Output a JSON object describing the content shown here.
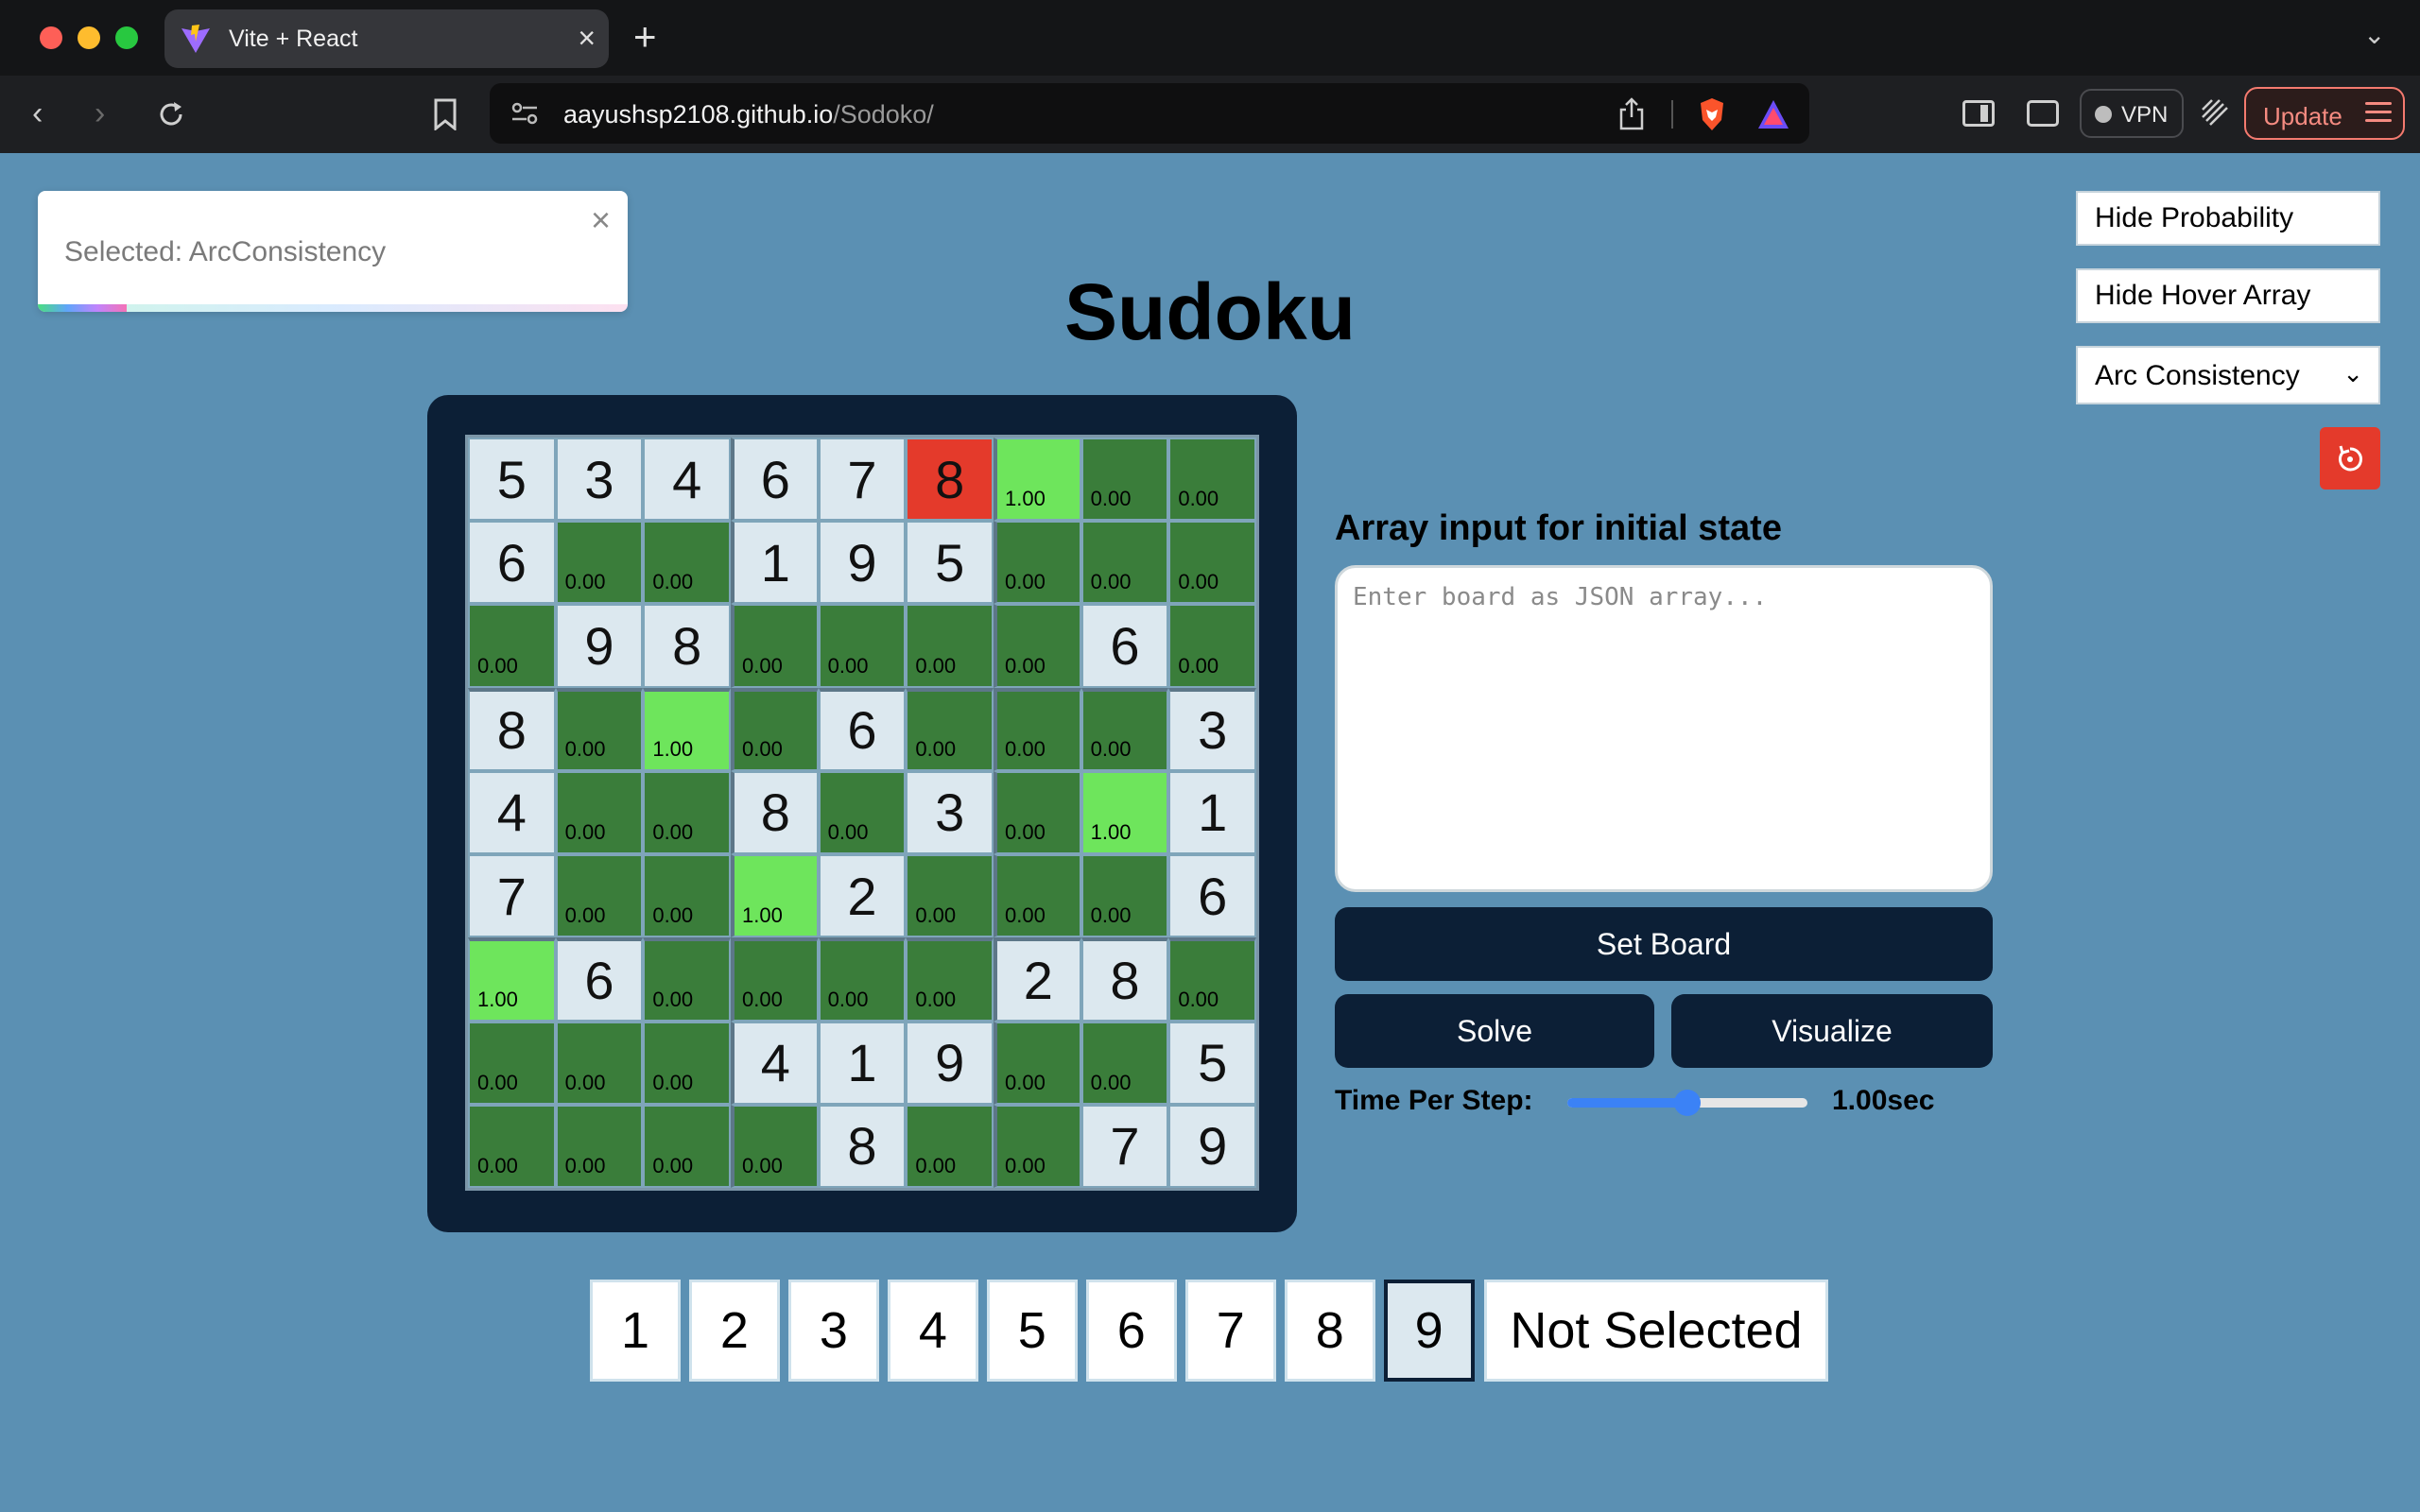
{
  "browser": {
    "tab_title": "Vite + React",
    "tab_close": "×",
    "new_tab": "+",
    "url_host": "aayushsp2108.github.io",
    "url_path": "/Sodoko/",
    "vpn_label": "VPN",
    "update_label": "Update"
  },
  "toast": {
    "message": "Selected: ArcConsistency",
    "close": "×",
    "progress_fraction": 0.15
  },
  "page": {
    "title": "Sudoku",
    "array_label": "Array input for initial state",
    "input_placeholder": "Enter board as JSON array...",
    "input_value": "",
    "set_board_label": "Set Board",
    "solve_label": "Solve",
    "visualize_label": "Visualize",
    "time_label": "Time Per Step:",
    "time_value": "1.00sec",
    "time_slider_fraction": 0.5
  },
  "controls": {
    "hide_probability": "Hide Probability",
    "hide_hover_array": "Hide Hover Array",
    "algorithm_selected": "Arc Consistency",
    "reset_icon": "reset-icon"
  },
  "board": [
    [
      {
        "v": "5",
        "s": "given"
      },
      {
        "v": "3",
        "s": "given"
      },
      {
        "v": "4",
        "s": "given"
      },
      {
        "v": "6",
        "s": "given"
      },
      {
        "v": "7",
        "s": "given"
      },
      {
        "v": "8",
        "s": "conflict"
      },
      {
        "p": "1.00",
        "s": "bright"
      },
      {
        "p": "0.00",
        "s": "empty"
      },
      {
        "p": "0.00",
        "s": "empty"
      }
    ],
    [
      {
        "v": "6",
        "s": "given"
      },
      {
        "p": "0.00",
        "s": "empty"
      },
      {
        "p": "0.00",
        "s": "empty"
      },
      {
        "v": "1",
        "s": "given"
      },
      {
        "v": "9",
        "s": "given"
      },
      {
        "v": "5",
        "s": "given"
      },
      {
        "p": "0.00",
        "s": "empty"
      },
      {
        "p": "0.00",
        "s": "empty"
      },
      {
        "p": "0.00",
        "s": "empty"
      }
    ],
    [
      {
        "p": "0.00",
        "s": "empty"
      },
      {
        "v": "9",
        "s": "given"
      },
      {
        "v": "8",
        "s": "given"
      },
      {
        "p": "0.00",
        "s": "empty"
      },
      {
        "p": "0.00",
        "s": "empty"
      },
      {
        "p": "0.00",
        "s": "empty"
      },
      {
        "p": "0.00",
        "s": "empty"
      },
      {
        "v": "6",
        "s": "given"
      },
      {
        "p": "0.00",
        "s": "empty"
      }
    ],
    [
      {
        "v": "8",
        "s": "given"
      },
      {
        "p": "0.00",
        "s": "empty"
      },
      {
        "p": "1.00",
        "s": "bright"
      },
      {
        "p": "0.00",
        "s": "empty"
      },
      {
        "v": "6",
        "s": "given"
      },
      {
        "p": "0.00",
        "s": "empty"
      },
      {
        "p": "0.00",
        "s": "empty"
      },
      {
        "p": "0.00",
        "s": "empty"
      },
      {
        "v": "3",
        "s": "given"
      }
    ],
    [
      {
        "v": "4",
        "s": "given"
      },
      {
        "p": "0.00",
        "s": "empty"
      },
      {
        "p": "0.00",
        "s": "empty"
      },
      {
        "v": "8",
        "s": "given"
      },
      {
        "p": "0.00",
        "s": "empty"
      },
      {
        "v": "3",
        "s": "given"
      },
      {
        "p": "0.00",
        "s": "empty"
      },
      {
        "p": "1.00",
        "s": "bright"
      },
      {
        "v": "1",
        "s": "given"
      }
    ],
    [
      {
        "v": "7",
        "s": "given"
      },
      {
        "p": "0.00",
        "s": "empty"
      },
      {
        "p": "0.00",
        "s": "empty"
      },
      {
        "p": "1.00",
        "s": "bright"
      },
      {
        "v": "2",
        "s": "given"
      },
      {
        "p": "0.00",
        "s": "empty"
      },
      {
        "p": "0.00",
        "s": "empty"
      },
      {
        "p": "0.00",
        "s": "empty"
      },
      {
        "v": "6",
        "s": "given"
      }
    ],
    [
      {
        "p": "1.00",
        "s": "bright"
      },
      {
        "v": "6",
        "s": "given"
      },
      {
        "p": "0.00",
        "s": "empty"
      },
      {
        "p": "0.00",
        "s": "empty"
      },
      {
        "p": "0.00",
        "s": "empty"
      },
      {
        "p": "0.00",
        "s": "empty"
      },
      {
        "v": "2",
        "s": "given"
      },
      {
        "v": "8",
        "s": "given"
      },
      {
        "p": "0.00",
        "s": "empty"
      }
    ],
    [
      {
        "p": "0.00",
        "s": "empty"
      },
      {
        "p": "0.00",
        "s": "empty"
      },
      {
        "p": "0.00",
        "s": "empty"
      },
      {
        "v": "4",
        "s": "given"
      },
      {
        "v": "1",
        "s": "given"
      },
      {
        "v": "9",
        "s": "given"
      },
      {
        "p": "0.00",
        "s": "empty"
      },
      {
        "p": "0.00",
        "s": "empty"
      },
      {
        "v": "5",
        "s": "given"
      }
    ],
    [
      {
        "p": "0.00",
        "s": "empty"
      },
      {
        "p": "0.00",
        "s": "empty"
      },
      {
        "p": "0.00",
        "s": "empty"
      },
      {
        "p": "0.00",
        "s": "empty"
      },
      {
        "v": "8",
        "s": "given"
      },
      {
        "p": "0.00",
        "s": "empty"
      },
      {
        "p": "0.00",
        "s": "empty"
      },
      {
        "v": "7",
        "s": "given"
      },
      {
        "v": "9",
        "s": "given"
      }
    ]
  ],
  "number_picker": {
    "numbers": [
      "1",
      "2",
      "3",
      "4",
      "5",
      "6",
      "7",
      "8",
      "9"
    ],
    "selected": "9",
    "not_selected_label": "Not Selected"
  },
  "colors": {
    "page_bg": "#5b90b3",
    "frame": "#0c1f36",
    "given_cell": "#dce8ef",
    "conflict_cell": "#e43a2b",
    "empty_cell": "#3a7d3a",
    "bright_cell": "#6ee55c",
    "accent_blue": "#3b82f6"
  }
}
